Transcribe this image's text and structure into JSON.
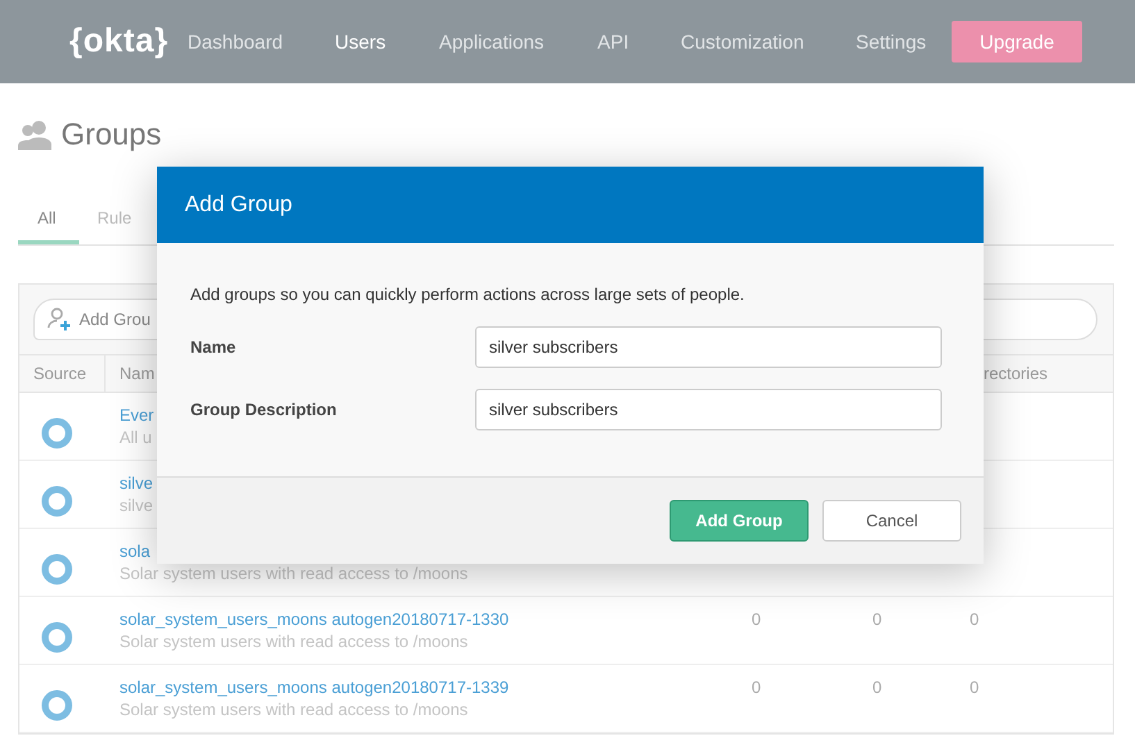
{
  "nav": {
    "logo": "{okta}",
    "items": [
      {
        "label": "Dashboard",
        "selected": false
      },
      {
        "label": "Users",
        "selected": true
      },
      {
        "label": "Applications",
        "selected": false
      },
      {
        "label": "API",
        "selected": false
      },
      {
        "label": "Customization",
        "selected": false
      },
      {
        "label": "Settings",
        "selected": false
      }
    ],
    "upgrade": "Upgrade"
  },
  "page": {
    "title": "Groups",
    "tabs": [
      {
        "label": "All",
        "selected": true
      },
      {
        "label": "Rule",
        "selected": false
      }
    ]
  },
  "table": {
    "search_placeholder": "Add Grou",
    "columns": [
      "Source",
      "Nam",
      "rectories"
    ],
    "rows": [
      {
        "name": "Ever",
        "description": "All u",
        "counts": []
      },
      {
        "name": "silve",
        "description": "silve",
        "counts": []
      },
      {
        "name": "sola",
        "description": "Solar system users with read access to /moons",
        "counts": []
      },
      {
        "name": "solar_system_users_moons autogen20180717-1330",
        "description": "Solar system users with read access to /moons",
        "counts": [
          "0",
          "0",
          "0"
        ]
      },
      {
        "name": "solar_system_users_moons autogen20180717-1339",
        "description": "Solar system users with read access to /moons",
        "counts": [
          "0",
          "0",
          "0"
        ]
      }
    ]
  },
  "dialog": {
    "title": "Add Group",
    "intro": "Add groups so you can quickly perform actions across large sets of people.",
    "fields": [
      {
        "label": "Name",
        "value": "silver subscribers"
      },
      {
        "label": "Group Description",
        "value": "silver subscribers"
      }
    ],
    "primary": "Add Group",
    "secondary": "Cancel"
  }
}
